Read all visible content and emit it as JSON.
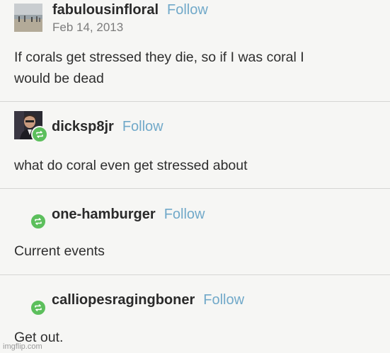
{
  "posts": [
    {
      "username": "fabulousinfloral",
      "follow_label": "Follow",
      "date": "Feb 14, 2013",
      "lines": [
        "If corals get stressed they die, so if I was coral I",
        "would be dead"
      ],
      "avatar_icon": "beach-photo-avatar"
    },
    {
      "username": "dicksp8jr",
      "follow_label": "Follow",
      "lines": [
        "what do coral even get stressed about"
      ],
      "avatar_icon": "person-photo-avatar",
      "badge_icon": "reblog-icon"
    },
    {
      "username": "one-hamburger",
      "follow_label": "Follow",
      "lines": [
        "Current events"
      ],
      "badge_icon": "reblog-icon"
    },
    {
      "username": "calliopesragingboner",
      "follow_label": "Follow",
      "lines": [
        "Get out."
      ],
      "badge_icon": "reblog-icon"
    }
  ],
  "watermark": "imgflip.com",
  "colors": {
    "follow": "#71a9c9",
    "reblog_badge": "#5cbf5c",
    "background": "#f6f6f4"
  }
}
